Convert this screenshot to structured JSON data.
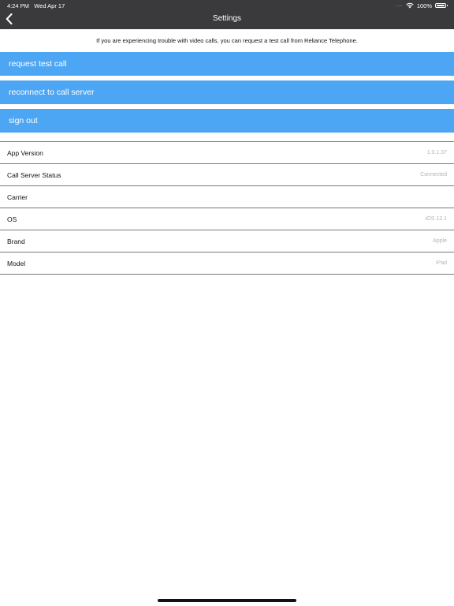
{
  "status_bar": {
    "time": "4:24 PM",
    "date": "Wed Apr 17",
    "signal": "....",
    "battery": "100%"
  },
  "nav": {
    "title": "Settings",
    "back_icon": "chevron-left-icon"
  },
  "info_text": "If you are experiencing trouble with video calls, you can request a test call from Reliance Telephone.",
  "actions": [
    {
      "label": "request test call"
    },
    {
      "label": "reconnect to call server"
    },
    {
      "label": "sign out"
    }
  ],
  "rows": [
    {
      "label": "App Version",
      "value": "1.0.1.37"
    },
    {
      "label": "Call Server Status",
      "value": "Connected"
    },
    {
      "label": "Carrier",
      "value": ""
    },
    {
      "label": "OS",
      "value": "iOS 12.1"
    },
    {
      "label": "Brand",
      "value": "Apple"
    },
    {
      "label": "Model",
      "value": "iPad"
    }
  ],
  "colors": {
    "accent": "#4da6f3",
    "topbar": "#3a3a3c"
  }
}
